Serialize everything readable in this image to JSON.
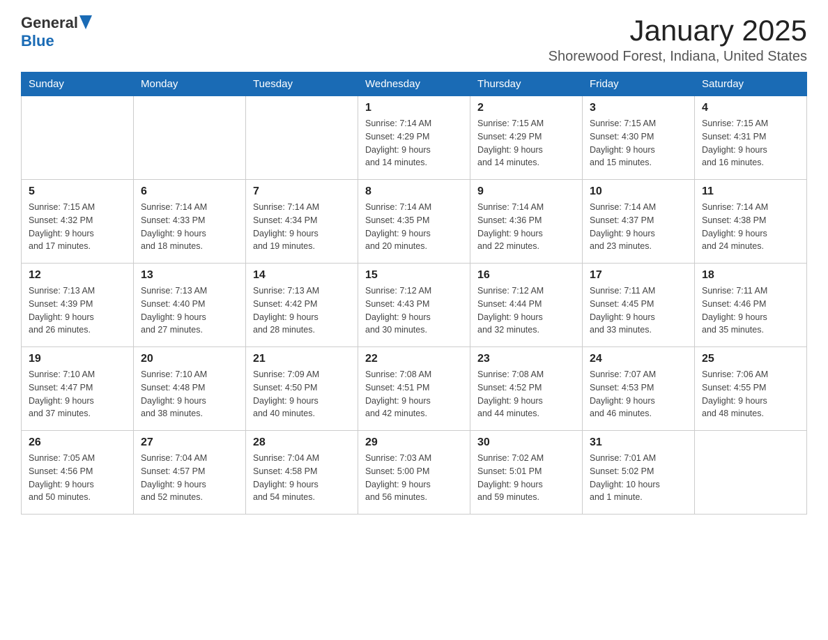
{
  "header": {
    "logo_general": "General",
    "logo_blue": "Blue",
    "month_title": "January 2025",
    "location": "Shorewood Forest, Indiana, United States"
  },
  "weekdays": [
    "Sunday",
    "Monday",
    "Tuesday",
    "Wednesday",
    "Thursday",
    "Friday",
    "Saturday"
  ],
  "weeks": [
    [
      {
        "day": "",
        "info": ""
      },
      {
        "day": "",
        "info": ""
      },
      {
        "day": "",
        "info": ""
      },
      {
        "day": "1",
        "info": "Sunrise: 7:14 AM\nSunset: 4:29 PM\nDaylight: 9 hours\nand 14 minutes."
      },
      {
        "day": "2",
        "info": "Sunrise: 7:15 AM\nSunset: 4:29 PM\nDaylight: 9 hours\nand 14 minutes."
      },
      {
        "day": "3",
        "info": "Sunrise: 7:15 AM\nSunset: 4:30 PM\nDaylight: 9 hours\nand 15 minutes."
      },
      {
        "day": "4",
        "info": "Sunrise: 7:15 AM\nSunset: 4:31 PM\nDaylight: 9 hours\nand 16 minutes."
      }
    ],
    [
      {
        "day": "5",
        "info": "Sunrise: 7:15 AM\nSunset: 4:32 PM\nDaylight: 9 hours\nand 17 minutes."
      },
      {
        "day": "6",
        "info": "Sunrise: 7:14 AM\nSunset: 4:33 PM\nDaylight: 9 hours\nand 18 minutes."
      },
      {
        "day": "7",
        "info": "Sunrise: 7:14 AM\nSunset: 4:34 PM\nDaylight: 9 hours\nand 19 minutes."
      },
      {
        "day": "8",
        "info": "Sunrise: 7:14 AM\nSunset: 4:35 PM\nDaylight: 9 hours\nand 20 minutes."
      },
      {
        "day": "9",
        "info": "Sunrise: 7:14 AM\nSunset: 4:36 PM\nDaylight: 9 hours\nand 22 minutes."
      },
      {
        "day": "10",
        "info": "Sunrise: 7:14 AM\nSunset: 4:37 PM\nDaylight: 9 hours\nand 23 minutes."
      },
      {
        "day": "11",
        "info": "Sunrise: 7:14 AM\nSunset: 4:38 PM\nDaylight: 9 hours\nand 24 minutes."
      }
    ],
    [
      {
        "day": "12",
        "info": "Sunrise: 7:13 AM\nSunset: 4:39 PM\nDaylight: 9 hours\nand 26 minutes."
      },
      {
        "day": "13",
        "info": "Sunrise: 7:13 AM\nSunset: 4:40 PM\nDaylight: 9 hours\nand 27 minutes."
      },
      {
        "day": "14",
        "info": "Sunrise: 7:13 AM\nSunset: 4:42 PM\nDaylight: 9 hours\nand 28 minutes."
      },
      {
        "day": "15",
        "info": "Sunrise: 7:12 AM\nSunset: 4:43 PM\nDaylight: 9 hours\nand 30 minutes."
      },
      {
        "day": "16",
        "info": "Sunrise: 7:12 AM\nSunset: 4:44 PM\nDaylight: 9 hours\nand 32 minutes."
      },
      {
        "day": "17",
        "info": "Sunrise: 7:11 AM\nSunset: 4:45 PM\nDaylight: 9 hours\nand 33 minutes."
      },
      {
        "day": "18",
        "info": "Sunrise: 7:11 AM\nSunset: 4:46 PM\nDaylight: 9 hours\nand 35 minutes."
      }
    ],
    [
      {
        "day": "19",
        "info": "Sunrise: 7:10 AM\nSunset: 4:47 PM\nDaylight: 9 hours\nand 37 minutes."
      },
      {
        "day": "20",
        "info": "Sunrise: 7:10 AM\nSunset: 4:48 PM\nDaylight: 9 hours\nand 38 minutes."
      },
      {
        "day": "21",
        "info": "Sunrise: 7:09 AM\nSunset: 4:50 PM\nDaylight: 9 hours\nand 40 minutes."
      },
      {
        "day": "22",
        "info": "Sunrise: 7:08 AM\nSunset: 4:51 PM\nDaylight: 9 hours\nand 42 minutes."
      },
      {
        "day": "23",
        "info": "Sunrise: 7:08 AM\nSunset: 4:52 PM\nDaylight: 9 hours\nand 44 minutes."
      },
      {
        "day": "24",
        "info": "Sunrise: 7:07 AM\nSunset: 4:53 PM\nDaylight: 9 hours\nand 46 minutes."
      },
      {
        "day": "25",
        "info": "Sunrise: 7:06 AM\nSunset: 4:55 PM\nDaylight: 9 hours\nand 48 minutes."
      }
    ],
    [
      {
        "day": "26",
        "info": "Sunrise: 7:05 AM\nSunset: 4:56 PM\nDaylight: 9 hours\nand 50 minutes."
      },
      {
        "day": "27",
        "info": "Sunrise: 7:04 AM\nSunset: 4:57 PM\nDaylight: 9 hours\nand 52 minutes."
      },
      {
        "day": "28",
        "info": "Sunrise: 7:04 AM\nSunset: 4:58 PM\nDaylight: 9 hours\nand 54 minutes."
      },
      {
        "day": "29",
        "info": "Sunrise: 7:03 AM\nSunset: 5:00 PM\nDaylight: 9 hours\nand 56 minutes."
      },
      {
        "day": "30",
        "info": "Sunrise: 7:02 AM\nSunset: 5:01 PM\nDaylight: 9 hours\nand 59 minutes."
      },
      {
        "day": "31",
        "info": "Sunrise: 7:01 AM\nSunset: 5:02 PM\nDaylight: 10 hours\nand 1 minute."
      },
      {
        "day": "",
        "info": ""
      }
    ]
  ]
}
